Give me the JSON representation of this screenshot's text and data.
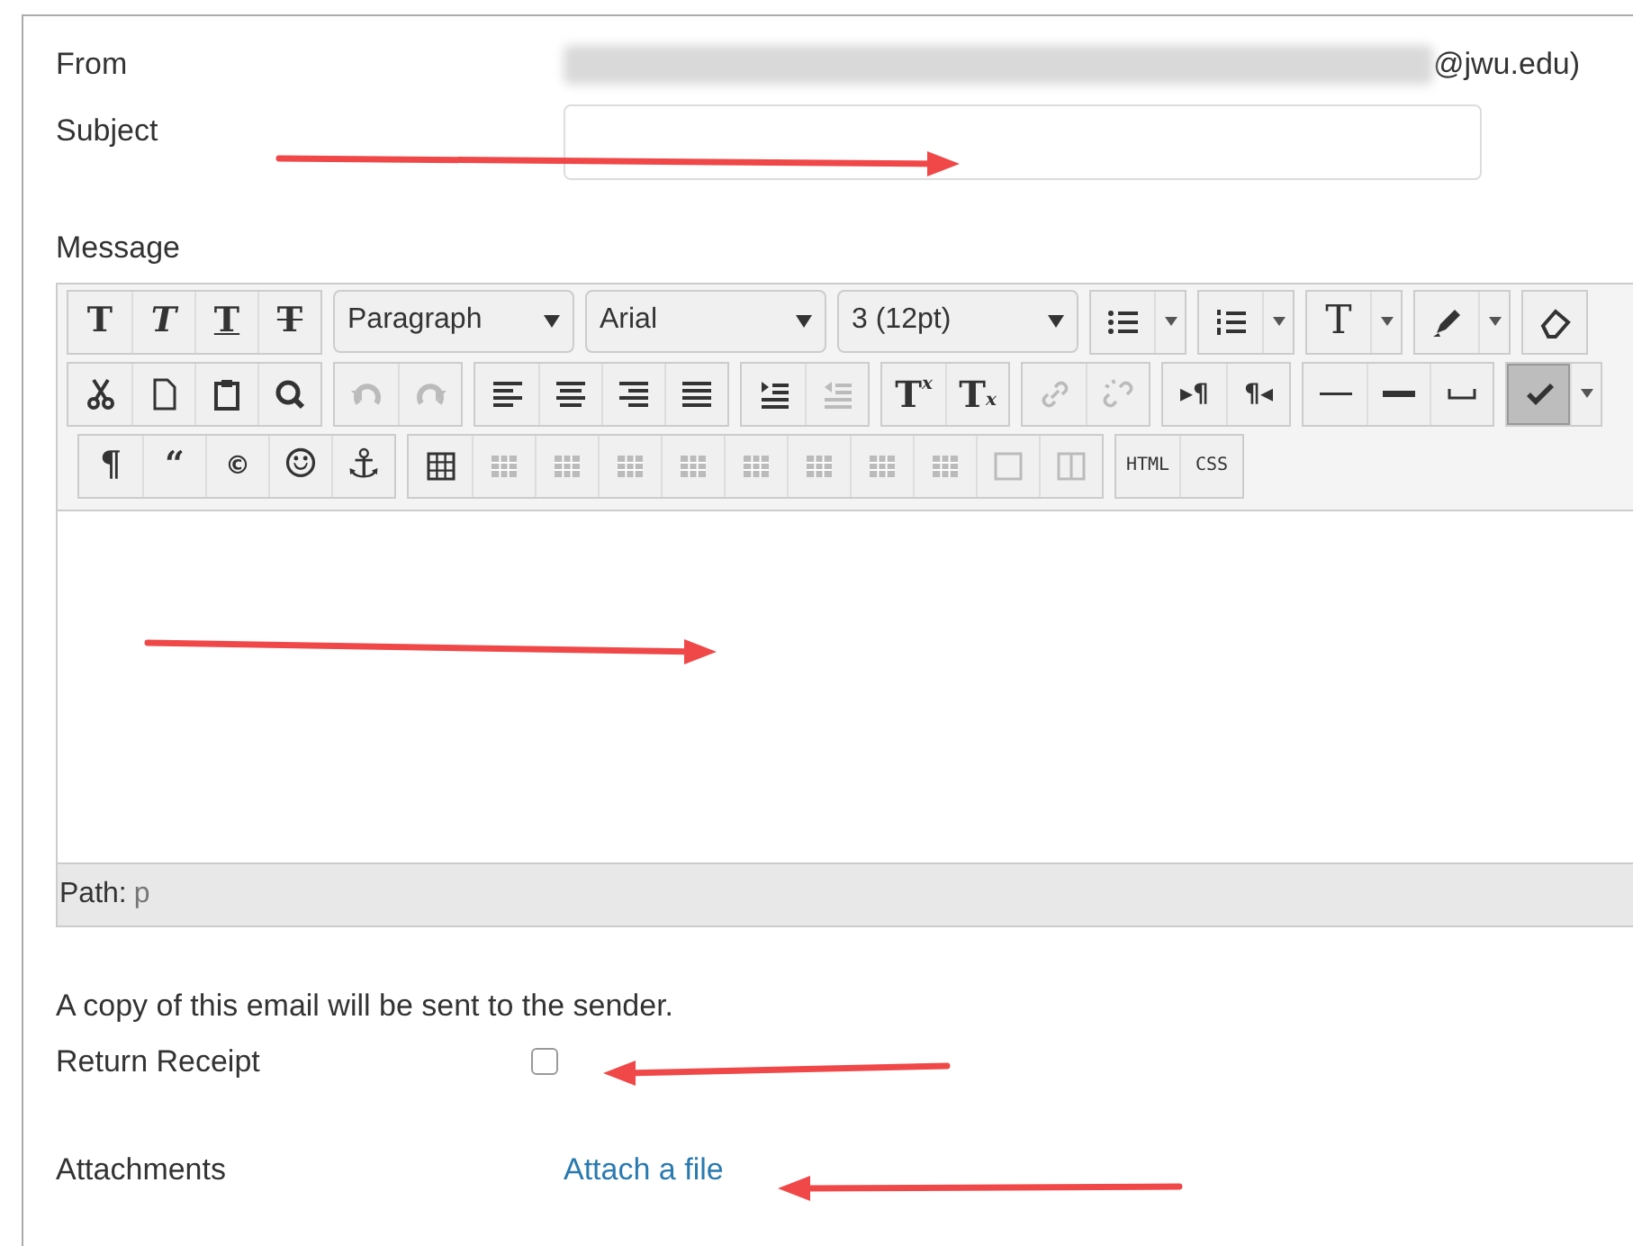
{
  "from": {
    "label": "From",
    "redacted": true,
    "suffix": "@jwu.edu)"
  },
  "subject": {
    "label": "Subject"
  },
  "message": {
    "label": "Message",
    "toolbar": [
      [
        {
          "kind": "group",
          "items": [
            {
              "kind": "text",
              "glyph": "T",
              "disabled": false,
              "on": false
            },
            {
              "kind": "text",
              "glyph": "T",
              "disabled": false,
              "on": false
            },
            {
              "kind": "text",
              "glyph": "T",
              "disabled": false,
              "on": false
            },
            {
              "kind": "text",
              "glyph": "T",
              "disabled": false,
              "on": false
            }
          ]
        },
        {
          "kind": "select",
          "value": "Paragraph"
        },
        {
          "kind": "select",
          "value": "Arial"
        },
        {
          "kind": "select",
          "value": "3 (12pt)"
        },
        {
          "kind": "group",
          "items": [
            {
              "kind": "icon",
              "menu": true,
              "disabled": false,
              "on": false
            }
          ]
        },
        {
          "kind": "group",
          "items": [
            {
              "kind": "icon",
              "menu": true,
              "disabled": false,
              "on": false
            }
          ]
        },
        {
          "kind": "group",
          "items": [
            {
              "kind": "text",
              "glyph": "T",
              "menu": true,
              "disabled": false,
              "on": false
            }
          ]
        },
        {
          "kind": "group",
          "items": [
            {
              "kind": "icon",
              "menu": true,
              "disabled": false,
              "on": false
            }
          ]
        },
        {
          "kind": "group",
          "items": [
            {
              "kind": "icon",
              "disabled": false,
              "on": false
            }
          ]
        }
      ],
      [
        {
          "kind": "group",
          "items": [
            {
              "kind": "icon",
              "disabled": false,
              "on": false
            },
            {
              "kind": "icon",
              "disabled": false,
              "on": false
            },
            {
              "kind": "icon",
              "disabled": false,
              "on": false
            },
            {
              "kind": "icon",
              "disabled": false,
              "on": false
            }
          ]
        },
        {
          "kind": "group",
          "items": [
            {
              "kind": "icon",
              "disabled": true,
              "on": false
            },
            {
              "kind": "icon",
              "disabled": true,
              "on": false
            }
          ]
        },
        {
          "kind": "group",
          "items": [
            {
              "kind": "icon",
              "disabled": false,
              "on": false
            },
            {
              "kind": "icon",
              "disabled": false,
              "on": false
            },
            {
              "kind": "icon",
              "disabled": false,
              "on": false
            },
            {
              "kind": "icon",
              "disabled": false,
              "on": false
            }
          ]
        },
        {
          "kind": "group",
          "items": [
            {
              "kind": "icon",
              "disabled": false,
              "on": false
            },
            {
              "kind": "icon",
              "disabled": true,
              "on": false
            }
          ]
        },
        {
          "kind": "group",
          "items": [
            {
              "kind": "text",
              "glyph": "T",
              "mark": "x",
              "disabled": false,
              "on": false
            },
            {
              "kind": "text",
              "glyph": "T",
              "mark": "x",
              "disabled": false,
              "on": false
            }
          ]
        },
        {
          "kind": "group",
          "items": [
            {
              "kind": "icon",
              "disabled": true,
              "on": false
            },
            {
              "kind": "icon",
              "disabled": true,
              "on": false
            }
          ]
        },
        {
          "kind": "group",
          "items": [
            {
              "kind": "text",
              "glyph": "▸¶",
              "disabled": false,
              "on": false
            },
            {
              "kind": "text",
              "glyph": "¶◂",
              "disabled": false,
              "on": false
            }
          ]
        },
        {
          "kind": "group",
          "items": [
            {
              "kind": "icon",
              "disabled": false,
              "on": false
            },
            {
              "kind": "icon",
              "disabled": false,
              "on": false
            },
            {
              "kind": "icon",
              "disabled": false,
              "on": false
            }
          ]
        },
        {
          "kind": "group",
          "items": [
            {
              "kind": "icon",
              "menu": true,
              "disabled": false,
              "on": true
            }
          ]
        }
      ],
      [
        {
          "kind": "group",
          "items": [
            {
              "kind": "text",
              "glyph": "¶",
              "disabled": false,
              "on": false
            },
            {
              "kind": "text",
              "glyph": "“",
              "disabled": false,
              "on": false
            },
            {
              "kind": "text",
              "glyph": "©",
              "disabled": false,
              "on": false
            },
            {
              "kind": "text",
              "glyph": "☺",
              "disabled": false,
              "on": false
            },
            {
              "kind": "text",
              "glyph": "⚓",
              "disabled": false,
              "on": false
            }
          ]
        },
        {
          "kind": "group",
          "items": [
            {
              "kind": "icon",
              "disabled": false,
              "on": false
            },
            {
              "kind": "icon",
              "disabled": true,
              "on": false
            },
            {
              "kind": "icon",
              "disabled": true,
              "on": false
            },
            {
              "kind": "icon",
              "disabled": true,
              "on": false
            },
            {
              "kind": "icon",
              "disabled": true,
              "on": false
            },
            {
              "kind": "icon",
              "disabled": true,
              "on": false
            },
            {
              "kind": "icon",
              "disabled": true,
              "on": false
            },
            {
              "kind": "icon",
              "disabled": true,
              "on": false
            },
            {
              "kind": "icon",
              "disabled": true,
              "on": false
            },
            {
              "kind": "icon",
              "disabled": true,
              "on": false
            },
            {
              "kind": "icon",
              "disabled": true,
              "on": false
            }
          ]
        },
        {
          "kind": "group",
          "items": [
            {
              "kind": "text",
              "glyph": "HTML",
              "disabled": false,
              "on": false
            },
            {
              "kind": "text",
              "glyph": "CSS",
              "disabled": false,
              "on": false
            }
          ]
        }
      ]
    ],
    "path_label": "Path:",
    "path_value": "p"
  },
  "copy_note": "A copy of this email will be sent to the sender.",
  "return_receipt": {
    "label": "Return Receipt",
    "checked": false
  },
  "attachments": {
    "label": "Attachments",
    "link": "Attach a file"
  },
  "annotations": [
    {
      "kind": "arrow"
    },
    {
      "kind": "arrow"
    },
    {
      "kind": "arrow"
    },
    {
      "kind": "arrow"
    }
  ]
}
